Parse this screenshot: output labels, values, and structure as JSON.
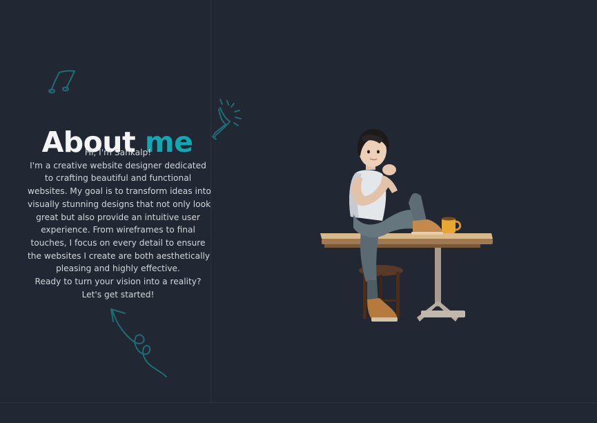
{
  "about": {
    "title_main": "About",
    "title_accent": "me",
    "greeting": "Hi, I'm Sankalp!",
    "bio_lines": [
      "I'm a creative website designer dedicated",
      "to crafting beautiful and functional",
      "websites. My goal is to transform ideas into",
      "visually stunning designs that not only look",
      "great but also provide an intuitive user",
      "experience. From wireframes to final",
      "touches, I focus on every detail to ensure",
      "the websites I create are both aesthetically",
      "pleasing and highly effective."
    ],
    "cta_lines": [
      "Ready to turn your vision into a reality?",
      "Let's get started!"
    ]
  },
  "decorations": {
    "music_icon": "music-note-doodle",
    "bulb_icon": "lightbulb-doodle",
    "arrow_icon": "curly-arrow-doodle",
    "illustration": "person-sitting-on-table-3d"
  },
  "colors": {
    "background": "#212733",
    "accent": "#11a7b3",
    "heading": "#f4f4f4",
    "body_text": "#d3d6db",
    "doodle": "#1f6d75"
  }
}
